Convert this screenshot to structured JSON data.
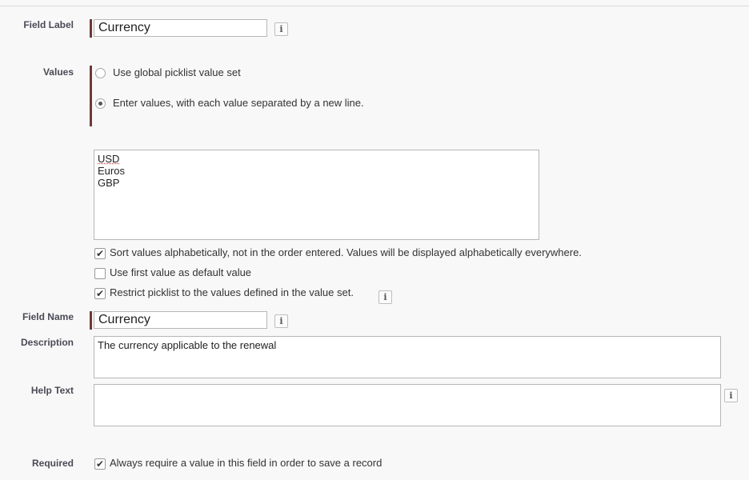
{
  "field_label": {
    "label": "Field Label",
    "value": "Currency"
  },
  "values": {
    "label": "Values",
    "options": [
      {
        "label": "Use global picklist value set",
        "selected": false
      },
      {
        "label": "Enter values, with each value separated by a new line.",
        "selected": true
      }
    ],
    "entries": [
      "USD",
      "Euros",
      "GBP"
    ],
    "checkboxes": [
      {
        "label": "Sort values alphabetically, not in the order entered. Values will be displayed alphabetically everywhere.",
        "checked": true
      },
      {
        "label": "Use first value as default value",
        "checked": false
      },
      {
        "label": "Restrict picklist to the values defined in the value set.",
        "checked": true
      }
    ]
  },
  "field_name": {
    "label": "Field Name",
    "value": "Currency"
  },
  "description": {
    "label": "Description",
    "value": "The currency applicable to the renewal"
  },
  "help_text": {
    "label": "Help Text",
    "value": ""
  },
  "required": {
    "label": "Required",
    "checkbox_label": "Always require a value in this field in order to save a record",
    "checked": true
  },
  "info_icon_glyph": "i",
  "check_glyph": "✔"
}
